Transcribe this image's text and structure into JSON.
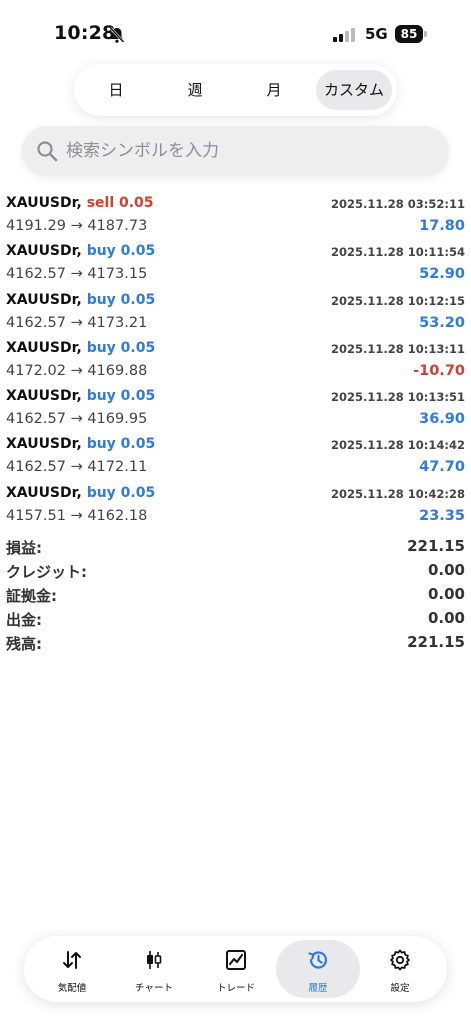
{
  "status": {
    "time": "10:28",
    "network": "5G",
    "battery": "85"
  },
  "period_tabs": [
    {
      "label": "日"
    },
    {
      "label": "週"
    },
    {
      "label": "月"
    },
    {
      "label": "カスタム",
      "active": true
    }
  ],
  "search": {
    "placeholder": "検索シンボルを入力"
  },
  "trades": [
    {
      "symbol": "XAUUSDr,",
      "side": "sell 0.05",
      "time": "2025.11.28 03:52:11",
      "prices": "4191.29 → 4187.73",
      "profit": "17.80"
    },
    {
      "symbol": "XAUUSDr,",
      "side": "buy 0.05",
      "time": "2025.11.28 10:11:54",
      "prices": "4162.57 → 4173.15",
      "profit": "52.90"
    },
    {
      "symbol": "XAUUSDr,",
      "side": "buy 0.05",
      "time": "2025.11.28 10:12:15",
      "prices": "4162.57 → 4173.21",
      "profit": "53.20"
    },
    {
      "symbol": "XAUUSDr,",
      "side": "buy 0.05",
      "time": "2025.11.28 10:13:11",
      "prices": "4172.02 → 4169.88",
      "profit": "-10.70"
    },
    {
      "symbol": "XAUUSDr,",
      "side": "buy 0.05",
      "time": "2025.11.28 10:13:51",
      "prices": "4162.57 → 4169.95",
      "profit": "36.90"
    },
    {
      "symbol": "XAUUSDr,",
      "side": "buy 0.05",
      "time": "2025.11.28 10:14:42",
      "prices": "4162.57 → 4172.11",
      "profit": "47.70"
    },
    {
      "symbol": "XAUUSDr,",
      "side": "buy 0.05",
      "time": "2025.11.28 10:42:28",
      "prices": "4157.51 → 4162.18",
      "profit": "23.35"
    }
  ],
  "summary": [
    {
      "label": "損益:",
      "value": "221.15"
    },
    {
      "label": "クレジット:",
      "value": "0.00"
    },
    {
      "label": "証拠金:",
      "value": "0.00"
    },
    {
      "label": "出金:",
      "value": "0.00"
    },
    {
      "label": "残高:",
      "value": "221.15"
    }
  ],
  "tabbar": [
    {
      "label": "気配値",
      "icon": "quotes-arrows-icon"
    },
    {
      "label": "チャート",
      "icon": "candlestick-chart-icon"
    },
    {
      "label": "トレード",
      "icon": "trade-chart-icon"
    },
    {
      "label": "履歴",
      "icon": "history-clock-icon",
      "active": true
    },
    {
      "label": "設定",
      "icon": "gear-icon"
    }
  ],
  "colors": {
    "buy": "#2d7be0",
    "sell": "#d23f31",
    "active_tab": "#2d7be0"
  }
}
